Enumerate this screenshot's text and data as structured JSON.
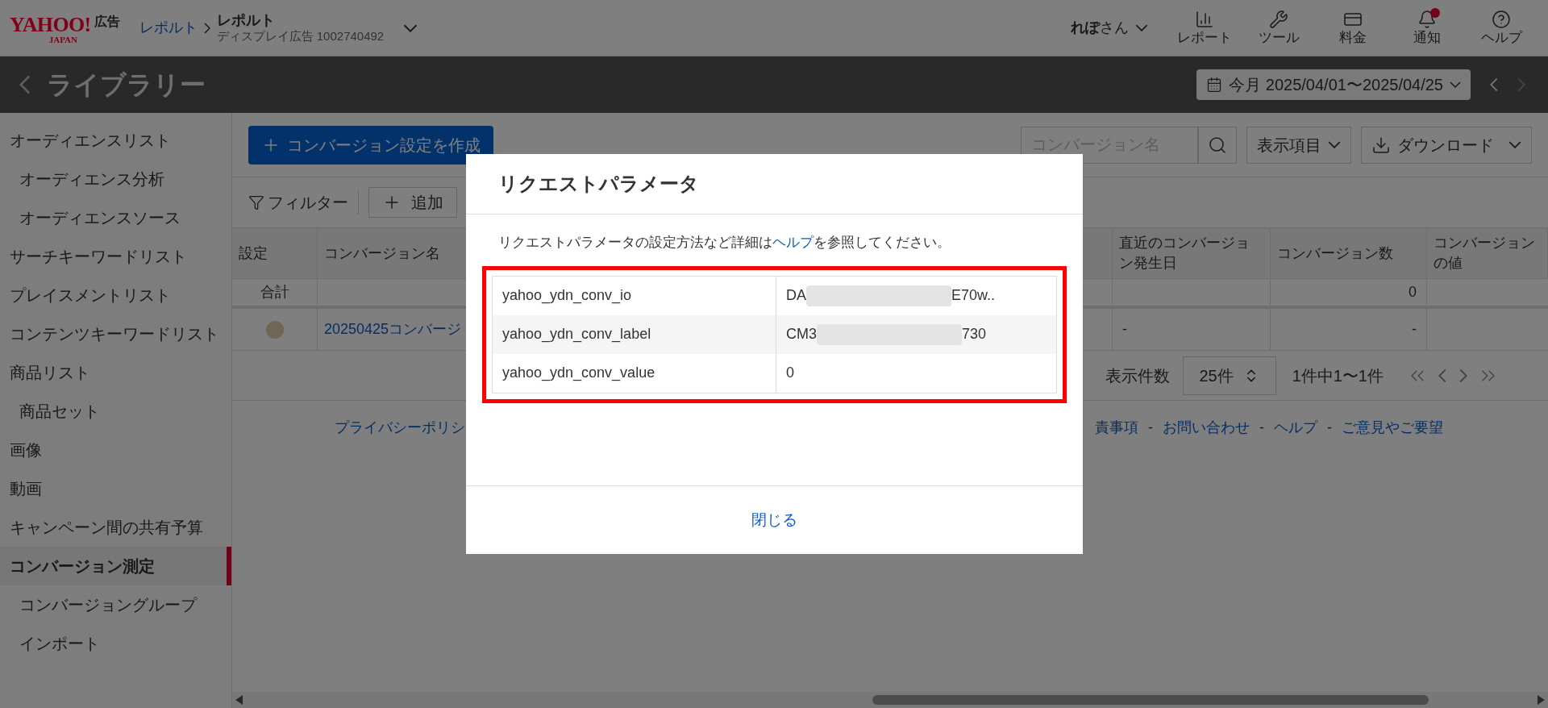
{
  "header": {
    "logo": {
      "brand": "YAHOO!",
      "region": "JAPAN",
      "service": "広告"
    },
    "breadcrumb": {
      "parent": "レポルト",
      "current": "レポルト",
      "subtitle": "ディスプレイ広告 1002740492"
    },
    "user": "**れぽ**さん",
    "nav": [
      {
        "kind": "report",
        "label": "レポート"
      },
      {
        "kind": "tool",
        "label": "ツール"
      },
      {
        "kind": "billing",
        "label": "料金"
      },
      {
        "kind": "notice",
        "label": "通知",
        "unread": true
      },
      {
        "kind": "help",
        "label": "ヘルプ"
      }
    ]
  },
  "page_bar": {
    "title": "ライブラリー",
    "period": "今月",
    "range": "2025/04/01〜2025/04/25",
    "next_disabled": true
  },
  "sidebar": {
    "items": [
      {
        "label": "オーディエンスリスト",
        "selected": false,
        "children": [
          {
            "label": "オーディエンス分析",
            "selected": false
          },
          {
            "label": "オーディエンスソース",
            "selected": false
          }
        ]
      },
      {
        "label": "サーチキーワードリスト",
        "selected": false
      },
      {
        "label": "プレイスメントリスト",
        "selected": false
      },
      {
        "label": "コンテンツキーワードリスト",
        "selected": false
      },
      {
        "label": "商品リスト",
        "selected": false,
        "children": [
          {
            "label": "商品セット",
            "selected": false
          }
        ]
      },
      {
        "label": "画像",
        "selected": false
      },
      {
        "label": "動画",
        "selected": false
      },
      {
        "label": "キャンペーン間の共有予算",
        "selected": false
      },
      {
        "label": "コンバージョン測定",
        "selected": true,
        "children": [
          {
            "label": "コンバージョングループ",
            "selected": false
          },
          {
            "label": "インポート",
            "selected": false
          }
        ]
      }
    ]
  },
  "toolbar": {
    "create_button": "コンバージョン設定を作成",
    "search": {
      "placeholder": "コンバージョン名"
    },
    "columns_button": "表示項目",
    "download_button": "ダウンロード",
    "filter_button": "フィルター",
    "add_button": "追加"
  },
  "table": {
    "columns": [
      "設定",
      "コンバージョン名",
      "直近のコンバージョン発生日",
      "コンバージョン数",
      "コンバージョンの値"
    ],
    "total_row": {
      "label": "合計",
      "conversions": "0"
    },
    "rows": [
      {
        "color": "#6f6655",
        "name": "20250425コンバージ",
        "last_date": "-",
        "conversions": "-"
      }
    ]
  },
  "pagination": {
    "per_page_label": "表示件数",
    "per_page": "25件",
    "summary": "1件中1〜1件"
  },
  "footer": {
    "left_link": "プライバシーポリシ",
    "right_links": [
      "責事項",
      "お問い合わせ",
      "ヘルプ",
      "ご意見やご要望"
    ],
    "separator": "-"
  },
  "modal": {
    "title": "リクエストパラメータ",
    "description_before": "リクエストパラメータの設定方法など詳細は",
    "description_link": "ヘルプ",
    "description_after": "を参照してください。",
    "params": [
      {
        "name": "yahoo_ydn_conv_io",
        "value_start": "DA",
        "value_end": "E70w..",
        "redacted": true
      },
      {
        "name": "yahoo_ydn_conv_label",
        "value_start": "CM3",
        "value_end": "730",
        "redacted": true
      },
      {
        "name": "yahoo_ydn_conv_value",
        "value_start": "0",
        "redacted": false
      }
    ],
    "close_button": "閉じる"
  }
}
